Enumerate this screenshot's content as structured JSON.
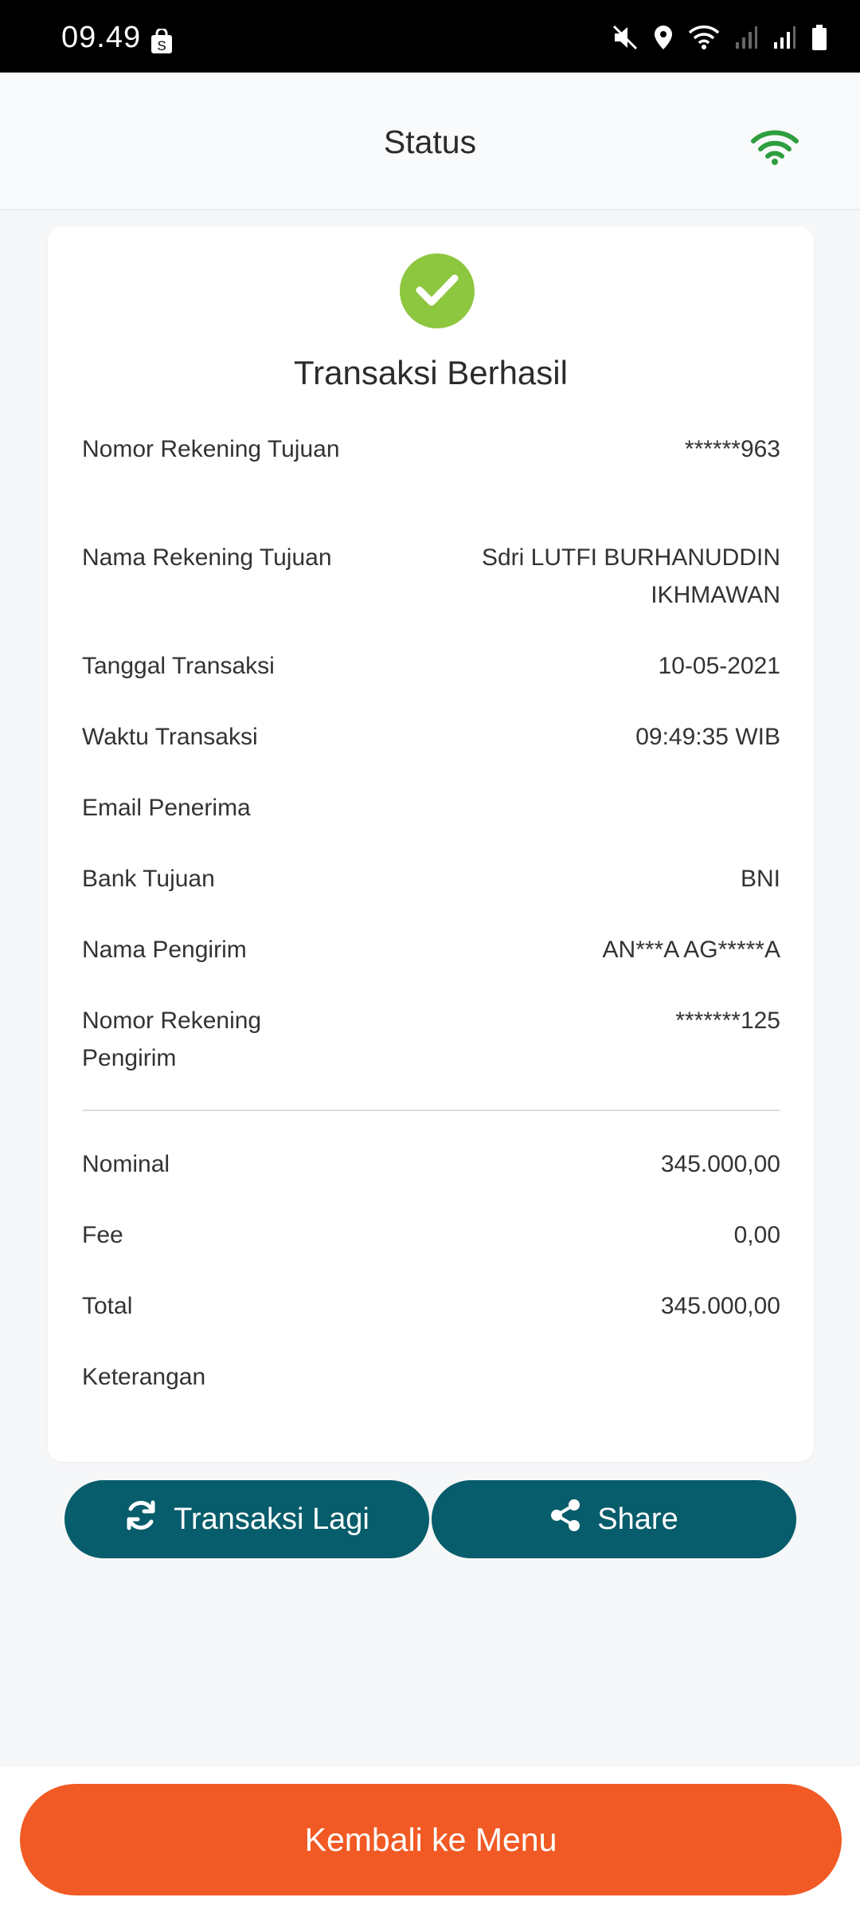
{
  "status_bar": {
    "time": "09.49"
  },
  "header": {
    "title": "Status"
  },
  "receipt": {
    "headline": "Transaksi Berhasil",
    "rows": [
      {
        "label": "Nomor Rekening Tujuan",
        "value": "******963"
      },
      {
        "label": "Nama Rekening Tujuan",
        "value": "Sdri LUTFI BURHANUDDIN IKHMAWAN"
      },
      {
        "label": "Tanggal Transaksi",
        "value": "10-05-2021"
      },
      {
        "label": "Waktu Transaksi",
        "value": "09:49:35 WIB"
      },
      {
        "label": "Email Penerima",
        "value": ""
      },
      {
        "label": "Bank Tujuan",
        "value": "BNI"
      },
      {
        "label": "Nama Pengirim",
        "value": "AN***A AG*****A"
      },
      {
        "label": "Nomor Rekening Pengirim",
        "value": "*******125"
      }
    ],
    "amounts": [
      {
        "label": "Nominal",
        "value": "345.000,00"
      },
      {
        "label": "Fee",
        "value": "0,00"
      },
      {
        "label": "Total",
        "value": "345.000,00"
      },
      {
        "label": "Keterangan",
        "value": ""
      }
    ]
  },
  "actions": {
    "again_label": "Transaksi Lagi",
    "share_label": "Share",
    "back_label": "Kembali ke Menu"
  },
  "colors": {
    "primary": "#075d6b",
    "accent": "#f15a24",
    "success": "#8dc63f",
    "wifi": "#2e9e3e"
  },
  "icons": [
    "shopping-bag-icon",
    "mute-icon",
    "location-icon",
    "wifi-status-icon",
    "signal-icon",
    "battery-icon",
    "wifi-icon",
    "check-icon",
    "refresh-icon",
    "share-icon"
  ]
}
